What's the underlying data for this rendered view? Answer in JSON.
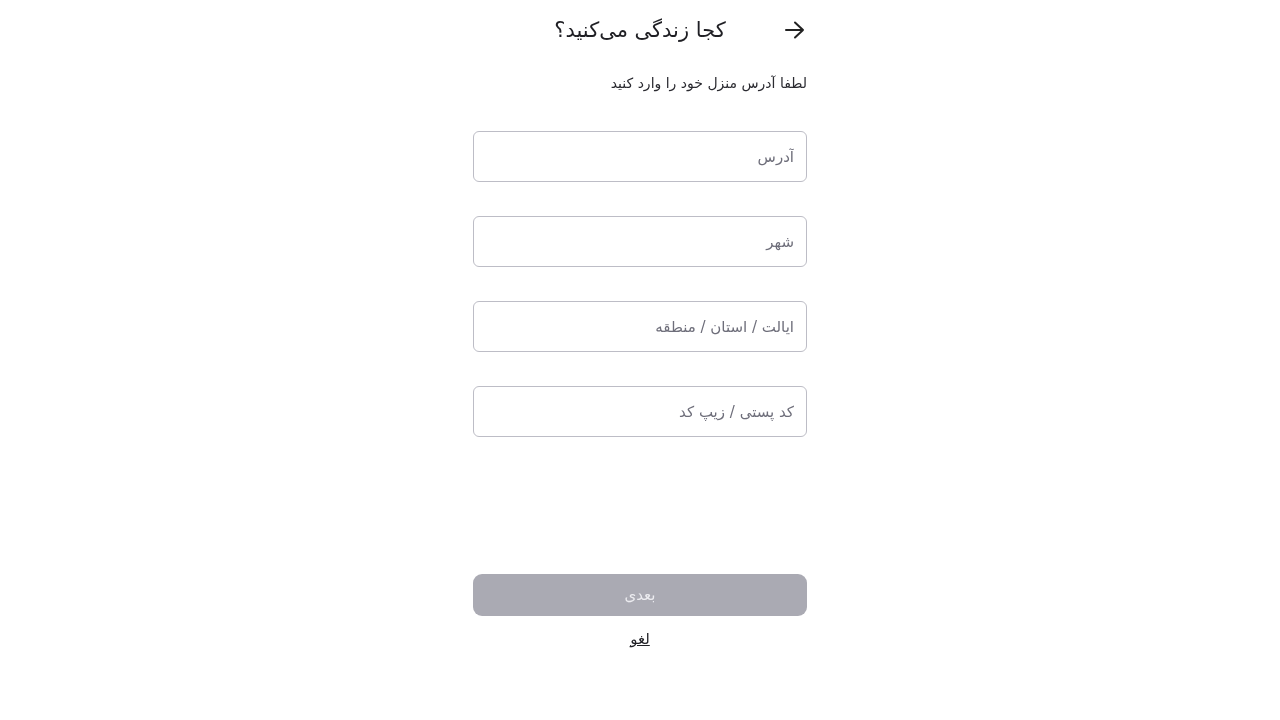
{
  "header": {
    "title": "کجا زندگی می‌کنید؟"
  },
  "subtitle": "لطفا آدرس منزل خود را وارد کنید",
  "fields": [
    {
      "placeholder": "آدرس"
    },
    {
      "placeholder": "شهر"
    },
    {
      "placeholder": "ایالت / استان / منطقه"
    },
    {
      "placeholder": "کد پستی / زیپ کد"
    }
  ],
  "next_button": {
    "label": "بعدی",
    "disabled": true
  },
  "cancel_link": {
    "label": "لغو"
  }
}
